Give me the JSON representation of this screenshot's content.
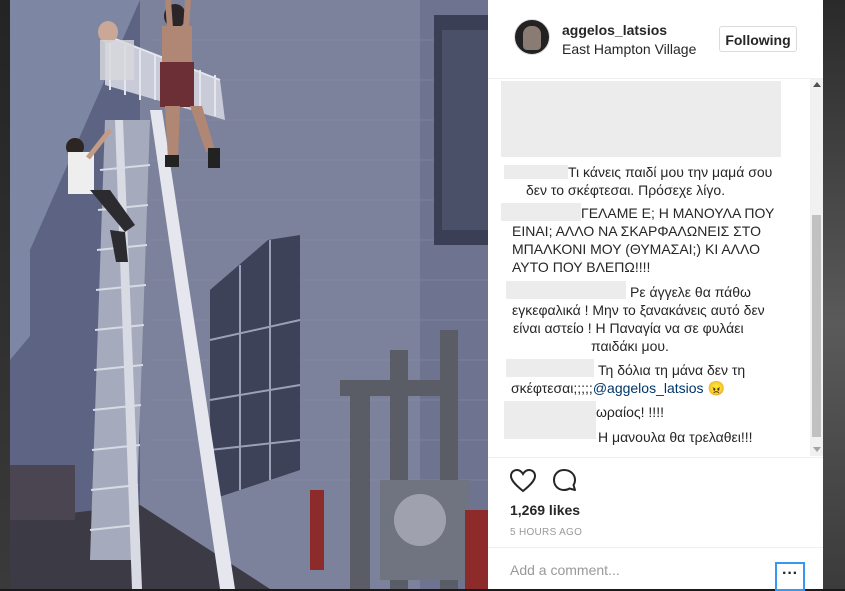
{
  "post": {
    "username": "aggelos_latsios",
    "location": "East Hampton Village",
    "follow_label": "Following",
    "likes": "1,269 likes",
    "timestamp": "5 HOURS AGO"
  },
  "comments": [
    {
      "lines": [
        "Τι κάνεις παιδί μου την μαμά σου",
        "δεν το σκέφτεσαι. Πρόσεχε λίγο."
      ]
    },
    {
      "lines": [
        "ΓΕΛΑΜΕ Ε; Η ΜΑΝΟΥΛΑ ΠΟΥ",
        "ΕΙΝΑΙ; ΑΛΛΟ ΝΑ ΣΚΑΡΦΑΛΩΝΕΙΣ ΣΤΟ",
        "ΜΠΑΛΚΟΝΙ ΜΟΥ (ΘΥΜΑΣΑΙ;) ΚΙ ΑΛΛΟ",
        "ΑΥΤΟ ΠΟΥ ΒΛΕΠΩ!!!!"
      ]
    },
    {
      "lines": [
        "Ρε άγγελε θα πάθω",
        "εγκεφαλικά ! Μην το ξανακάνεις αυτό δεν",
        "είναι αστείο ! Η Παναγία να σε φυλάει",
        "παιδάκι μου."
      ]
    },
    {
      "lines": [
        "Τη δόλια τη μάνα δεν τη",
        "σκέφτεσαι;;;;;"
      ],
      "mention": "@aggelos_latsios",
      "emoji": "😠"
    },
    {
      "lines": [
        "ωραίος! !!!!",
        "Η μανουλα θα τρελαθει!!!"
      ]
    }
  ],
  "comment_input": {
    "placeholder": "Add a comment..."
  },
  "icons": {
    "like": "heart-icon",
    "comment": "comment-icon",
    "more": "more-options-icon"
  },
  "colors": {
    "link": "#003569",
    "accent": "#3897f0",
    "text": "#262626",
    "muted": "#999999"
  }
}
